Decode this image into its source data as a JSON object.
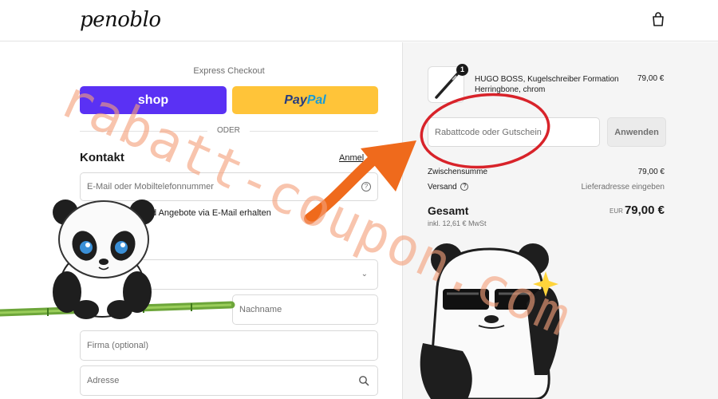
{
  "header": {
    "logo_text": "penoblo",
    "cart_icon": "shopping-bag-icon"
  },
  "checkout": {
    "express_title": "Express Checkout",
    "shop_label": "shop",
    "paypal_label_a": "Pay",
    "paypal_label_b": "Pal",
    "divider_label": "ODER",
    "contact_title": "Kontakt",
    "login_link": "Anmel",
    "email_placeholder": "E-Mail oder Mobiltelefonnummer",
    "newsletter_label": "d Angebote via E-Mail erhalten",
    "lastname_placeholder": "Nachname",
    "company_placeholder": "Firma (optional)",
    "address_placeholder": "Adresse"
  },
  "summary": {
    "product_name": "HUGO BOSS, Kugelschreiber Formation Herringbone, chrom",
    "product_price": "79,00 €",
    "quantity": "1",
    "coupon_placeholder": "Rabattcode oder Gutschein",
    "apply_label": "Anwenden",
    "subtotal_label": "Zwischensumme",
    "subtotal_value": "79,00 €",
    "shipping_label": "Versand",
    "shipping_value": "Lieferadresse eingeben",
    "total_label": "Gesamt",
    "total_currency": "EUR",
    "total_value": "79,00 €",
    "vat_note": "inkl. 12,61 € MwSt"
  },
  "watermark": {
    "text": "rabatt-coupon.com"
  },
  "colors": {
    "shop_purple": "#5a31f4",
    "paypal_yellow": "#ffc439",
    "watermark_orange": "#f4a07a",
    "arrow_orange": "#ef6a1c",
    "circle_red": "#d8232a"
  }
}
